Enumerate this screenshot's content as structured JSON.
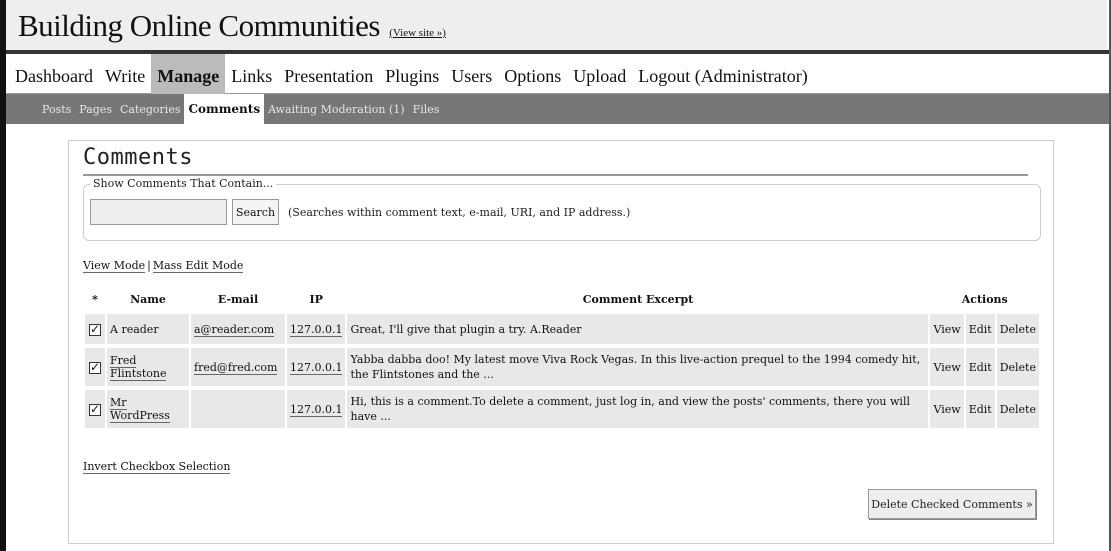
{
  "site": {
    "title": "Building Online Communities",
    "view_site_link": "(View site »)"
  },
  "main_nav": [
    "Dashboard",
    "Write",
    "Manage",
    "Links",
    "Presentation",
    "Plugins",
    "Users",
    "Options",
    "Upload",
    "Logout (Administrator)"
  ],
  "main_nav_active": "Manage",
  "sub_nav": [
    "Posts",
    "Pages",
    "Categories",
    "Comments",
    "Awaiting Moderation (1)",
    "Files"
  ],
  "sub_nav_active": "Comments",
  "page": {
    "title": "Comments",
    "search_legend": "Show Comments That Contain...",
    "search_value": "",
    "search_button": "Search",
    "search_hint": "(Searches within comment text, e-mail, URI, and IP address.)",
    "view_mode": "View Mode",
    "separator": "|",
    "mass_edit_mode": "Mass Edit Mode",
    "invert_selection": "Invert Checkbox Selection",
    "delete_checked": "Delete Checked Comments »"
  },
  "table": {
    "headers": {
      "select": "*",
      "name": "Name",
      "email": "E-mail",
      "ip": "IP",
      "excerpt": "Comment Excerpt",
      "actions": "Actions"
    },
    "rows": [
      {
        "checked": true,
        "name": "A reader",
        "name_linked": false,
        "email": "a@reader.com",
        "ip": "127.0.0.1",
        "excerpt": "Great, I'll give that plugin a try. A.Reader",
        "actions": [
          "View",
          "Edit",
          "Delete"
        ]
      },
      {
        "checked": true,
        "name": "Fred Flintstone",
        "name_linked": true,
        "email": "fred@fred.com",
        "ip": "127.0.0.1",
        "excerpt": "Yabba dabba doo! My latest move Viva Rock Vegas. In this live-action prequel to the 1994 comedy hit, the Flintstones and the ...",
        "actions": [
          "View",
          "Edit",
          "Delete"
        ]
      },
      {
        "checked": true,
        "name": "Mr WordPress",
        "name_linked": true,
        "email": "",
        "ip": "127.0.0.1",
        "excerpt": "Hi, this is a comment.To delete a comment, just log in, and view the posts' comments, there you will have ...",
        "actions": [
          "View",
          "Edit",
          "Delete"
        ]
      }
    ]
  },
  "colors": {
    "header_bg": "#eeeeee",
    "nav_active_bg": "#bbbbbb",
    "subnav_bg": "#777777",
    "row_bg": "#e8e8e8"
  },
  "icons": {
    "checked_box": "checkmark-icon"
  }
}
